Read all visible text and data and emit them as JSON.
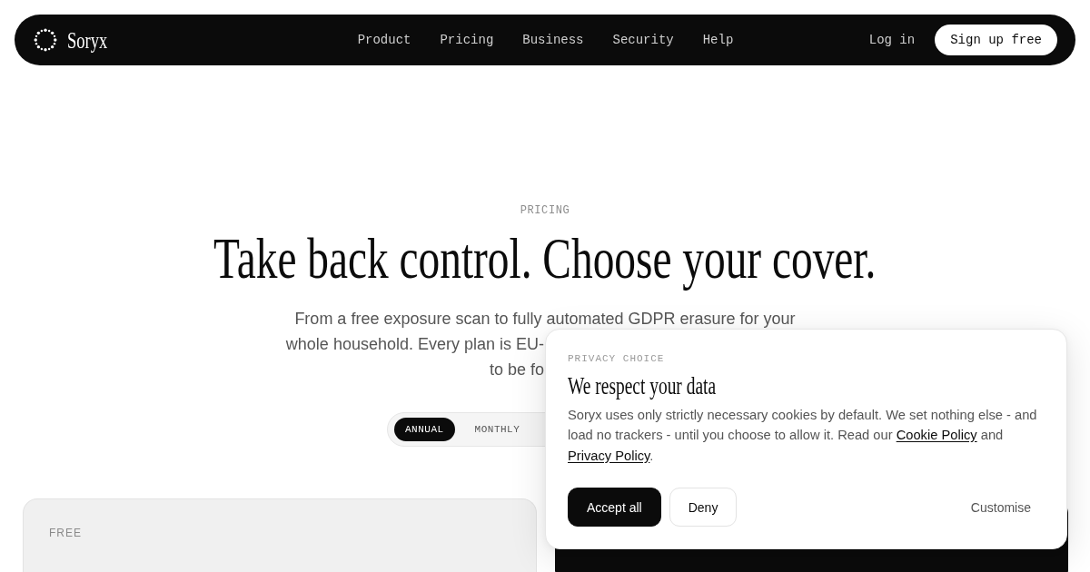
{
  "nav": {
    "brand": "Soryx",
    "links": [
      "Product",
      "Pricing",
      "Business",
      "Security",
      "Help"
    ],
    "login": "Log in",
    "cta": "Sign up free"
  },
  "hero": {
    "eyebrow": "PRICING",
    "title": "Take back control. Choose your cover.",
    "lead_lines": [
      "From a free exposure scan to fully automated GDPR erasure for your",
      "whole household. Every plan is EU-",
      "to be fo"
    ]
  },
  "billing_toggle": [
    {
      "label": "ANNUAL",
      "selected": true
    },
    {
      "label": "MONTHLY",
      "selected": false
    }
  ],
  "plans": [
    {
      "kind": "light",
      "label": "FREE"
    },
    {
      "kind": "dark"
    }
  ],
  "cookie_dialog": {
    "eyebrow": "PRIVACY CHOICE",
    "title": "We respect your data",
    "body": [
      {
        "kind": "text",
        "text": "Soryx uses only strictly necessary cookies by default. We set nothing else - and load no trackers - until you choose to allow it. Read our "
      },
      {
        "kind": "link",
        "text": "Cookie Policy"
      },
      {
        "kind": "text",
        "text": " and "
      },
      {
        "kind": "link",
        "text": "Privacy Policy"
      },
      {
        "kind": "text",
        "text": "."
      }
    ],
    "buttons": [
      {
        "kind": "solid",
        "label": "Accept all"
      },
      {
        "kind": "outline",
        "label": "Deny"
      },
      {
        "kind": "plain",
        "label": "Customise"
      }
    ]
  }
}
